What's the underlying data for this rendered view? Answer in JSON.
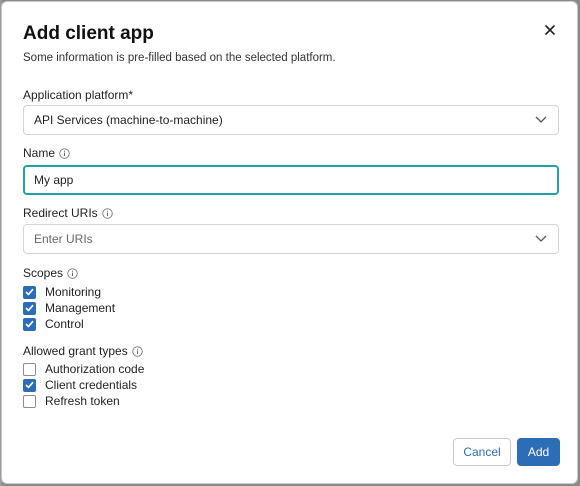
{
  "dialog": {
    "title": "Add client app",
    "subtitle": "Some information is pre-filled based on the selected platform."
  },
  "platform": {
    "label": "Application platform*",
    "value": "API Services (machine-to-machine)"
  },
  "name": {
    "label": "Name",
    "value": "My app"
  },
  "redirect": {
    "label": "Redirect URIs",
    "placeholder": "Enter URIs"
  },
  "scopes": {
    "label": "Scopes",
    "items": [
      {
        "label": "Monitoring",
        "checked": true
      },
      {
        "label": "Management",
        "checked": true
      },
      {
        "label": "Control",
        "checked": true
      }
    ]
  },
  "grants": {
    "label": "Allowed grant types",
    "items": [
      {
        "label": "Authorization code",
        "checked": false
      },
      {
        "label": "Client credentials",
        "checked": true
      },
      {
        "label": "Refresh token",
        "checked": false
      }
    ]
  },
  "actions": {
    "cancel": "Cancel",
    "add": "Add"
  },
  "colors": {
    "accent": "#2d6db5",
    "focus": "#1fa3a6"
  },
  "icons": {
    "close": "close-icon",
    "info": "info-icon",
    "chevron": "chevron-down-icon",
    "check": "checkmark-icon"
  }
}
